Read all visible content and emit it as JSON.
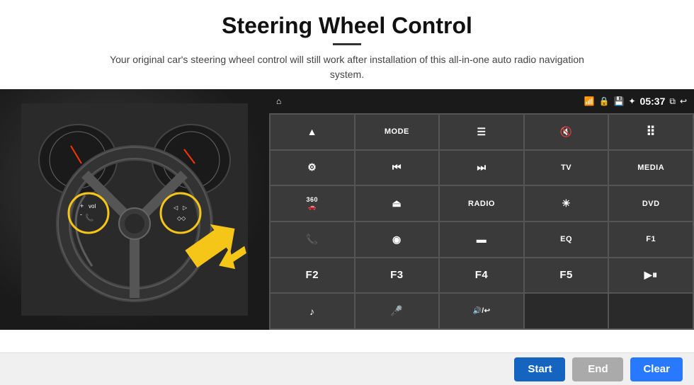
{
  "page": {
    "title": "Steering Wheel Control",
    "subtitle": "Your original car's steering wheel control will still work after installation of this all-in-one auto radio navigation system."
  },
  "status_bar": {
    "time": "05:37",
    "wifi_icon": "wifi",
    "lock_icon": "lock",
    "sd_icon": "sd",
    "bt_icon": "bt",
    "window_icon": "window",
    "back_icon": "back",
    "home_icon": "home"
  },
  "buttons": [
    {
      "id": "r1c1",
      "label": "▲",
      "type": "icon"
    },
    {
      "id": "r1c2",
      "label": "MODE",
      "type": "text"
    },
    {
      "id": "r1c3",
      "label": "☰",
      "type": "icon"
    },
    {
      "id": "r1c4",
      "label": "🔇",
      "type": "icon"
    },
    {
      "id": "r1c5",
      "label": "⋯",
      "type": "icon"
    },
    {
      "id": "r2c1",
      "label": "⚙",
      "type": "icon"
    },
    {
      "id": "r2c2",
      "label": "⏮",
      "type": "icon"
    },
    {
      "id": "r2c3",
      "label": "⏭",
      "type": "icon"
    },
    {
      "id": "r2c4",
      "label": "TV",
      "type": "text"
    },
    {
      "id": "r2c5",
      "label": "MEDIA",
      "type": "text"
    },
    {
      "id": "r3c1",
      "label": "360",
      "type": "text"
    },
    {
      "id": "r3c2",
      "label": "▲",
      "type": "icon"
    },
    {
      "id": "r3c3",
      "label": "RADIO",
      "type": "text"
    },
    {
      "id": "r3c4",
      "label": "☀",
      "type": "icon"
    },
    {
      "id": "r3c5",
      "label": "DVD",
      "type": "text"
    },
    {
      "id": "r4c1",
      "label": "📞",
      "type": "icon"
    },
    {
      "id": "r4c2",
      "label": "◎",
      "type": "icon"
    },
    {
      "id": "r4c3",
      "label": "▬",
      "type": "icon"
    },
    {
      "id": "r4c4",
      "label": "EQ",
      "type": "text"
    },
    {
      "id": "r4c5",
      "label": "F1",
      "type": "text"
    },
    {
      "id": "r5c1",
      "label": "F2",
      "type": "text"
    },
    {
      "id": "r5c2",
      "label": "F3",
      "type": "text"
    },
    {
      "id": "r5c3",
      "label": "F4",
      "type": "text"
    },
    {
      "id": "r5c4",
      "label": "F5",
      "type": "text"
    },
    {
      "id": "r5c5",
      "label": "▶⏸",
      "type": "text"
    },
    {
      "id": "r6c1",
      "label": "♪",
      "type": "icon"
    },
    {
      "id": "r6c2",
      "label": "🎤",
      "type": "icon"
    },
    {
      "id": "r6c3",
      "label": "🔊/↩",
      "type": "icon"
    },
    {
      "id": "r6c4",
      "label": "",
      "type": "empty"
    },
    {
      "id": "r6c5",
      "label": "",
      "type": "empty"
    }
  ],
  "bottom_buttons": {
    "start_label": "Start",
    "end_label": "End",
    "clear_label": "Clear"
  }
}
